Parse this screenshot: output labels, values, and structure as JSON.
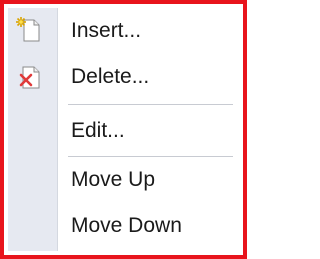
{
  "context_menu": {
    "items": [
      {
        "label": "Insert...",
        "icon": "insert-page-icon"
      },
      {
        "label": "Delete...",
        "icon": "delete-page-icon"
      },
      {
        "label": "Edit..."
      },
      {
        "label": "Move Up"
      },
      {
        "label": "Move Down"
      }
    ]
  },
  "colors": {
    "highlight_border": "#e8141c",
    "gutter": "#e6e9f1",
    "separator": "#c8cbd2",
    "text": "#1a1a1a"
  }
}
